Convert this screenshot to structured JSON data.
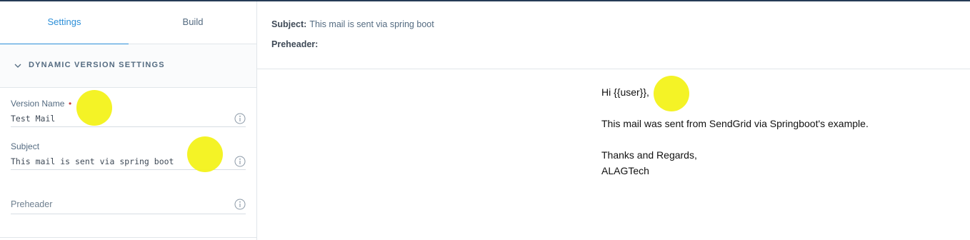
{
  "tabs": [
    {
      "label": "Settings",
      "active": true
    },
    {
      "label": "Build",
      "active": false
    }
  ],
  "section": {
    "title": "DYNAMIC VERSION SETTINGS",
    "icon": "chevron-down-icon"
  },
  "fields": {
    "version_name": {
      "label": "Version Name",
      "required_mark": "•",
      "value": "Test Mail",
      "icon": "info-icon"
    },
    "subject": {
      "label": "Subject",
      "value": "This mail is sent via spring boot",
      "icon": "info-icon"
    },
    "preheader": {
      "placeholder": "Preheader",
      "icon": "info-icon"
    }
  },
  "preview": {
    "subject_key": "Subject:",
    "subject_value": "This mail is sent via spring boot",
    "preheader_key": "Preheader:"
  },
  "email": {
    "greeting": "Hi {{user}},",
    "line1": "This mail was sent from SendGrid via Springboot's example.",
    "closing": "Thanks and Regards,",
    "signature": "ALAGTech"
  },
  "colors": {
    "accent": "#2c8fd8",
    "required": "#c53b3b",
    "highlight": "#f3f21a",
    "topbar": "#263c56"
  }
}
